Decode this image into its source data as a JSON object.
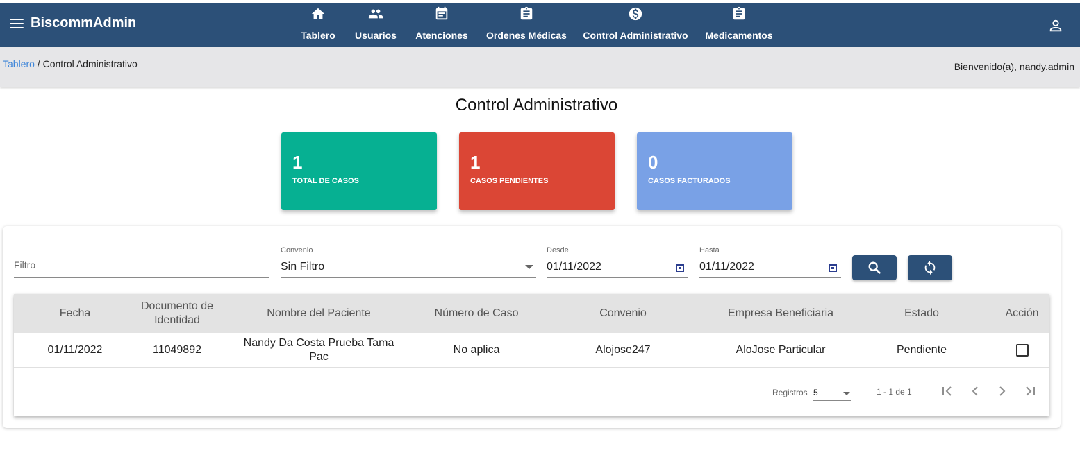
{
  "app": {
    "title": "BiscommAdmin"
  },
  "nav": [
    {
      "label": "Tablero",
      "icon": "home-icon"
    },
    {
      "label": "Usuarios",
      "icon": "people-icon"
    },
    {
      "label": "Atenciones",
      "icon": "calendar-icon"
    },
    {
      "label": "Ordenes Médicas",
      "icon": "clipboard-icon"
    },
    {
      "label": "Control Administrativo",
      "icon": "dollar-icon"
    },
    {
      "label": "Medicamentos",
      "icon": "clipboard-icon"
    }
  ],
  "breadcrumb": {
    "home": "Tablero",
    "separator": " / ",
    "current": "Control Administrativo"
  },
  "welcome": "Bienvenido(a), nandy.admin",
  "page_title": "Control Administrativo",
  "cards": [
    {
      "value": "1",
      "label": "TOTAL DE CASOS",
      "color": "#06b092"
    },
    {
      "value": "1",
      "label": "CASOS PENDIENTES",
      "color": "#db4635"
    },
    {
      "value": "0",
      "label": "CASOS FACTURADOS",
      "color": "#79a1e6"
    }
  ],
  "filters": {
    "filter_placeholder": "Filtro",
    "convenio_label": "Convenio",
    "convenio_value": "Sin Filtro",
    "desde_label": "Desde",
    "desde_value": "01/11/2022",
    "hasta_label": "Hasta",
    "hasta_value": "01/11/2022"
  },
  "table": {
    "headers": [
      "Fecha",
      "Documento de Identidad",
      "Nombre del Paciente",
      "Número de Caso",
      "Convenio",
      "Empresa Beneficiaria",
      "Estado",
      "Acción"
    ],
    "rows": [
      {
        "fecha": "01/11/2022",
        "documento": "11049892",
        "nombre": "Nandy Da Costa Prueba Tama Pac",
        "caso": "No aplica",
        "convenio": "Alojose247",
        "empresa": "AloJose Particular",
        "estado": "Pendiente",
        "accion_checked": false
      }
    ]
  },
  "pager": {
    "label": "Registros",
    "page_size": "5",
    "range": "1 - 1 de 1"
  },
  "colors": {
    "primary": "#2c5078",
    "link": "#3f86d9"
  }
}
